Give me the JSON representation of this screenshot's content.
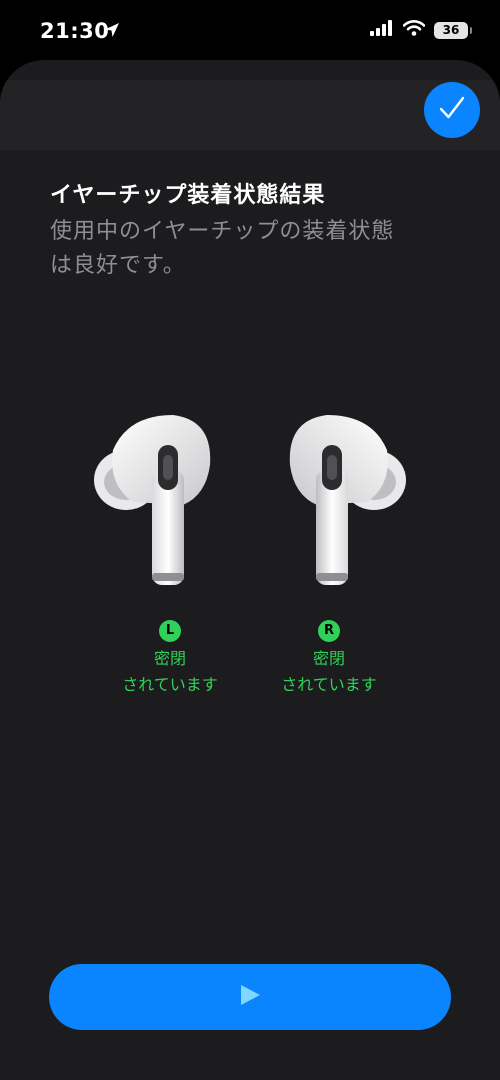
{
  "status_bar": {
    "time": "21:30",
    "battery": "36"
  },
  "header": {
    "title": "イヤーチップ装着状態結果"
  },
  "description": {
    "line1": "使用中のイヤーチップの装着状態",
    "line2": "は良好です。"
  },
  "earbuds": {
    "left": {
      "badge": "L",
      "status_line1": "密閉",
      "status_line2": "されています"
    },
    "right": {
      "badge": "R",
      "status_line1": "密閉",
      "status_line2": "されています"
    }
  },
  "colors": {
    "accent": "#0a84ff",
    "success": "#30d158",
    "sheet": "#1c1c1e"
  },
  "icons": {
    "done": "checkmark-icon",
    "play": "play-icon"
  }
}
